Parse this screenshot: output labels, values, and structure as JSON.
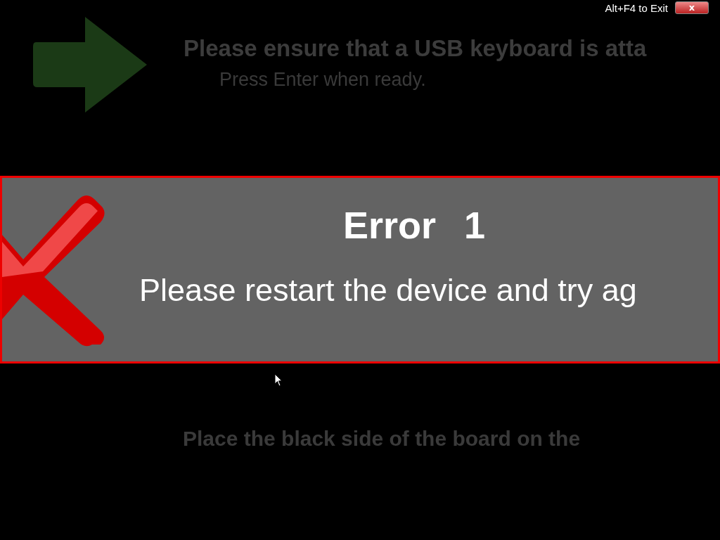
{
  "exit_bar": {
    "hint": "Alt+F4 to Exit",
    "close_label": "x"
  },
  "step_above": {
    "title": "Please ensure that a USB keyboard is atta",
    "subtitle": "Press Enter when ready."
  },
  "error_dialog": {
    "title": "Error",
    "code": "1",
    "message": "Please restart the device and try ag"
  },
  "step_below": {
    "title": "Place the black side of the board on the"
  }
}
